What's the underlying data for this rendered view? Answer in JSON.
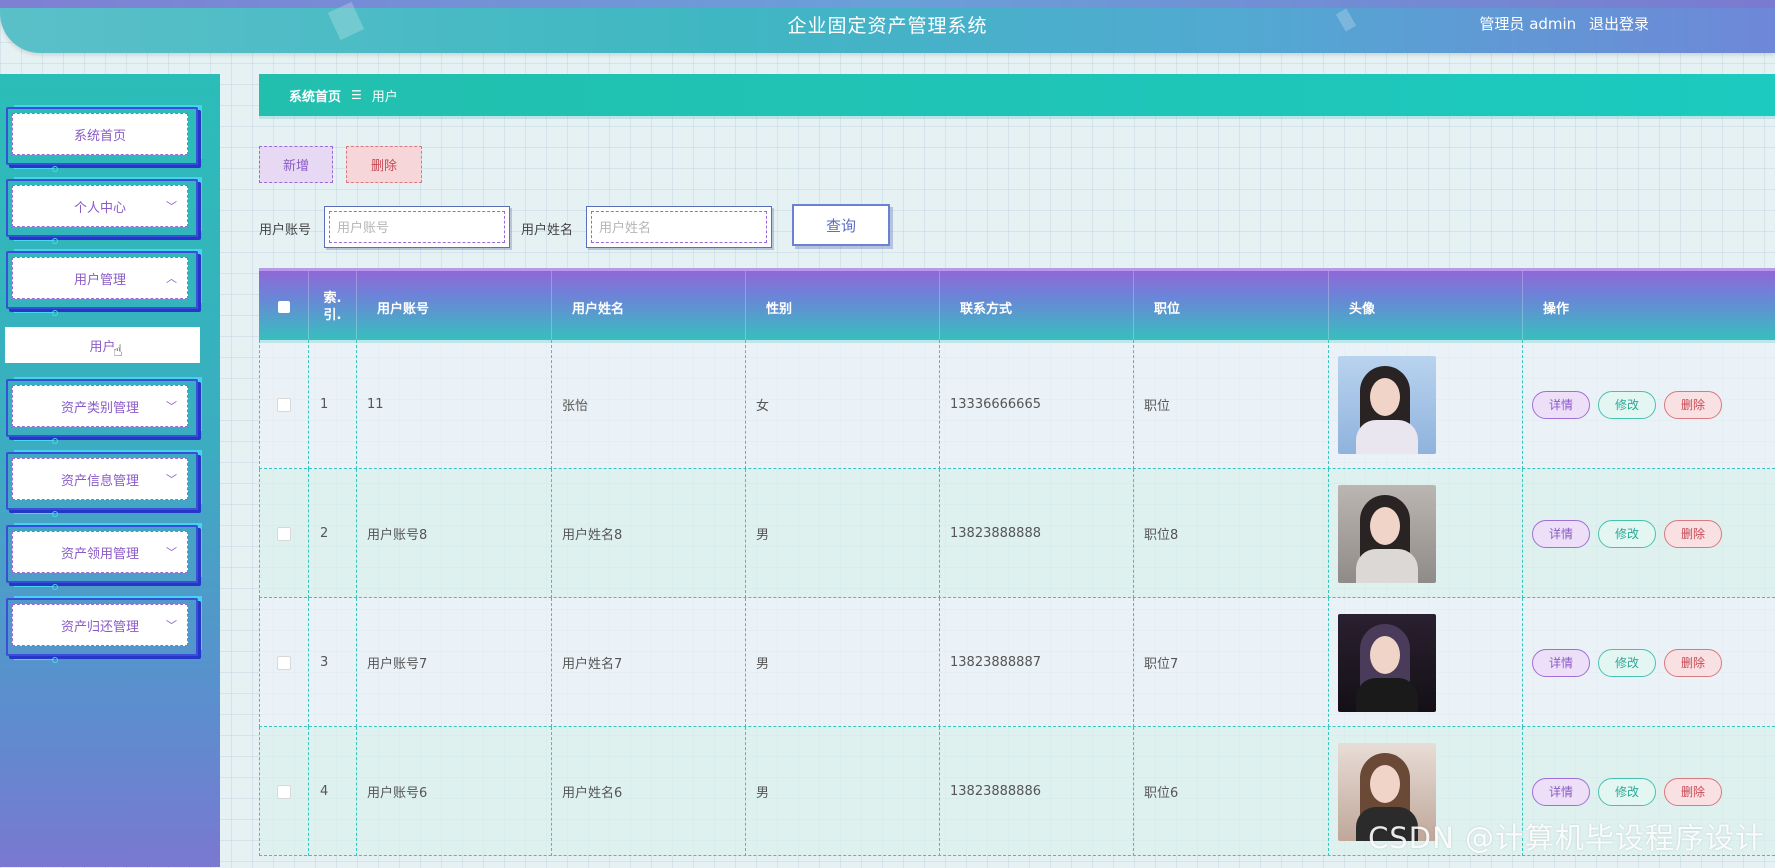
{
  "header": {
    "title": "企业固定资产管理系统",
    "user_label": "管理员 admin",
    "logout_label": "退出登录"
  },
  "sidebar": {
    "items": [
      {
        "label": "系统首页",
        "expanded": null
      },
      {
        "label": "个人中心",
        "expanded": false
      },
      {
        "label": "用户管理",
        "expanded": true
      },
      {
        "label": "资产类别管理",
        "expanded": false
      },
      {
        "label": "资产信息管理",
        "expanded": false
      },
      {
        "label": "资产领用管理",
        "expanded": false
      },
      {
        "label": "资产归还管理",
        "expanded": false
      }
    ],
    "submenu": {
      "label": "用户"
    }
  },
  "breadcrumb": {
    "home": "系统首页",
    "separator": "☰",
    "current": "用户"
  },
  "toolbar": {
    "add_label": "新增",
    "delete_label": "删除"
  },
  "search": {
    "account_label": "用户账号",
    "account_placeholder": "用户账号",
    "name_label": "用户姓名",
    "name_placeholder": "用户姓名",
    "query_label": "查询"
  },
  "table": {
    "headers": {
      "index": "索.\n引.",
      "account": "用户账号",
      "name": "用户姓名",
      "gender": "性别",
      "phone": "联系方式",
      "position": "职位",
      "avatar": "头像",
      "actions": "操作"
    },
    "rows": [
      {
        "index": "1",
        "account": "11",
        "name": "张怡",
        "gender": "女",
        "phone": "13336666665",
        "position": "职位"
      },
      {
        "index": "2",
        "account": "用户账号8",
        "name": "用户姓名8",
        "gender": "男",
        "phone": "13823888888",
        "position": "职位8"
      },
      {
        "index": "3",
        "account": "用户账号7",
        "name": "用户姓名7",
        "gender": "男",
        "phone": "13823888887",
        "position": "职位7"
      },
      {
        "index": "4",
        "account": "用户账号6",
        "name": "用户姓名6",
        "gender": "男",
        "phone": "13823888886",
        "position": "职位6"
      }
    ],
    "action_labels": {
      "detail": "详情",
      "edit": "修改",
      "delete": "删除"
    }
  },
  "colors": {
    "accent_teal": "#1ccabf",
    "accent_purple": "#8a5bc8",
    "danger": "#c74a55"
  },
  "watermark": "CSDN @计算机毕设程序设计"
}
